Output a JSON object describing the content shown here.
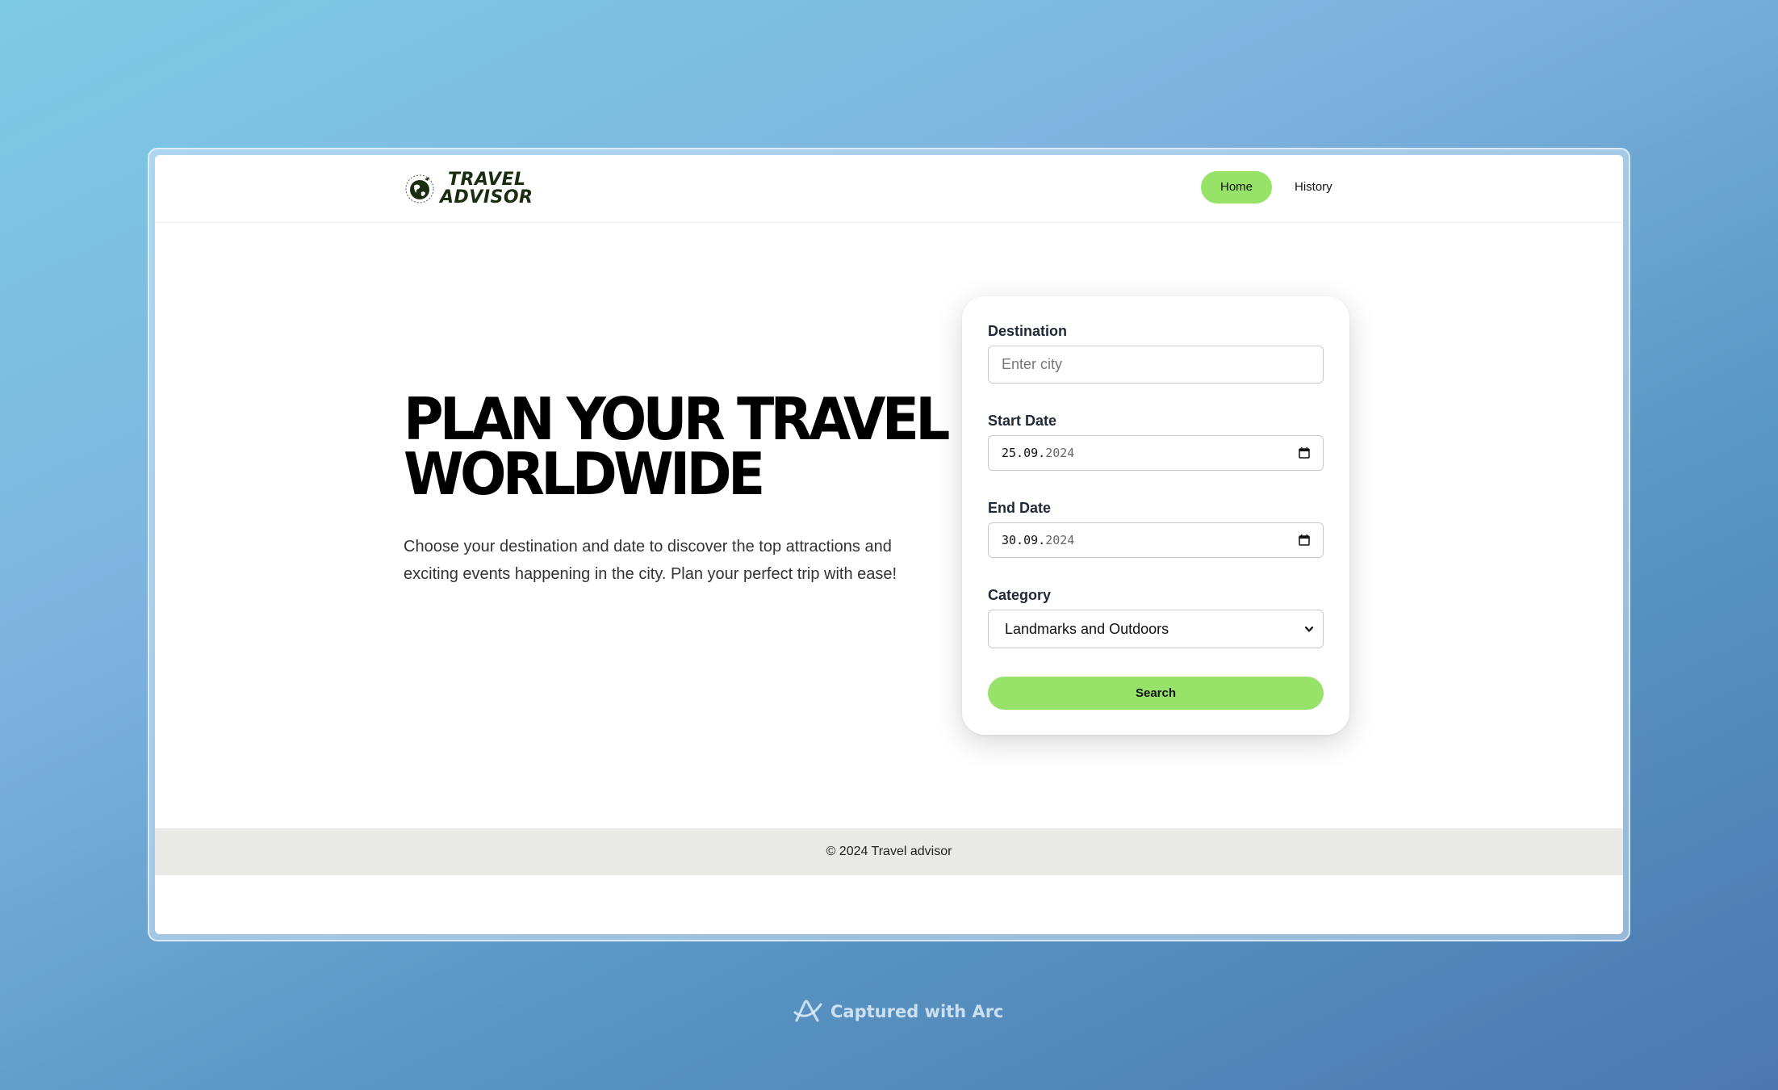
{
  "brand": {
    "name_line1": "TRAVEL",
    "name_line2": "ADVISOR",
    "logo_icon": "globe-icon"
  },
  "nav": {
    "items": [
      {
        "label": "Home",
        "active": true
      },
      {
        "label": "History",
        "active": false
      }
    ]
  },
  "hero": {
    "title_line1": "PLAN YOUR TRAVEL",
    "title_line2": "WORLDWIDE",
    "description": "Choose your destination and date to discover the top attractions and exciting events happening in the city. Plan your perfect trip with ease!"
  },
  "form": {
    "destination": {
      "label": "Destination",
      "placeholder": "Enter city",
      "value": ""
    },
    "start_date": {
      "label": "Start Date",
      "day_month": "25.09.",
      "year": "2024"
    },
    "end_date": {
      "label": "End Date",
      "day_month": "30.09.",
      "year": "2024"
    },
    "category": {
      "label": "Category",
      "selected": "Landmarks and Outdoors"
    },
    "submit_label": "Search"
  },
  "footer": {
    "text": "© 2024 Travel advisor"
  },
  "capture_badge": {
    "text": "Captured with Arc"
  },
  "colors": {
    "accent": "#97e36a",
    "footer_bg": "#e9eae6",
    "brand_dark": "#1b2d10"
  }
}
